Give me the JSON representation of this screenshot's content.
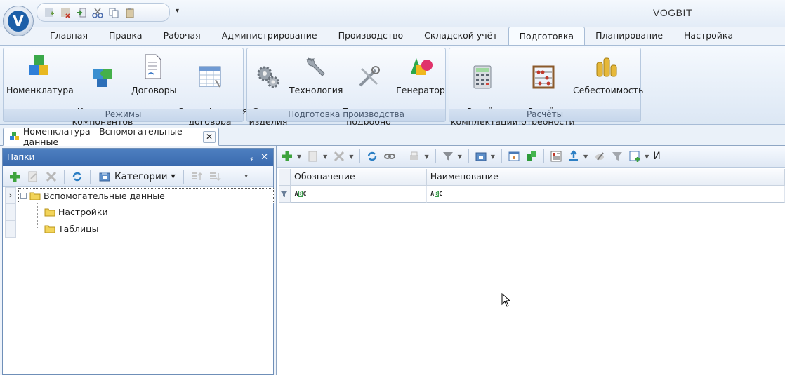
{
  "app": {
    "title": "VOGBIT",
    "logo_letter": "V"
  },
  "ribbon_tabs": [
    "Главная",
    "Правка",
    "Рабочая",
    "Администрирование",
    "Производство",
    "Складской учёт",
    "Подготовка",
    "Планирование",
    "Настройка"
  ],
  "active_tab": "Подготовка",
  "groups": {
    "modes": {
      "label": "Режимы",
      "buttons": [
        "Номенклатура",
        "Коллекции\nкомпонентов",
        "Договоры",
        "Спецификация\nдоговора"
      ]
    },
    "production_prep": {
      "label": "Подготовка производства",
      "buttons": [
        "Состав\nизделия",
        "Технология",
        "Технология\nподробно",
        "Генератор"
      ]
    },
    "calcs": {
      "label": "Расчёты",
      "buttons": [
        "Расчёт\nкомплектации",
        "Расчёт\nпотребности",
        "Себестоимость"
      ]
    }
  },
  "document_tab": {
    "title": "Номенклатура - Вспомогательные данные",
    "close": "✕"
  },
  "folders_panel": {
    "title": "Папки",
    "pin": "ᵩ",
    "close": "✕",
    "categories_label": "Категории",
    "tree": {
      "root": "Вспомогательные данные",
      "children": [
        "Настройки",
        "Таблицы"
      ]
    }
  },
  "grid": {
    "columns": [
      "Обозначение",
      "Наименование"
    ],
    "filter_row": [
      "ABC",
      "ABC"
    ],
    "toolbar_overflow_text": "И"
  },
  "colors": {
    "accent": "#3a6aae",
    "ribbon_bg": "#dce7f4",
    "folder": "#e8c84a"
  }
}
